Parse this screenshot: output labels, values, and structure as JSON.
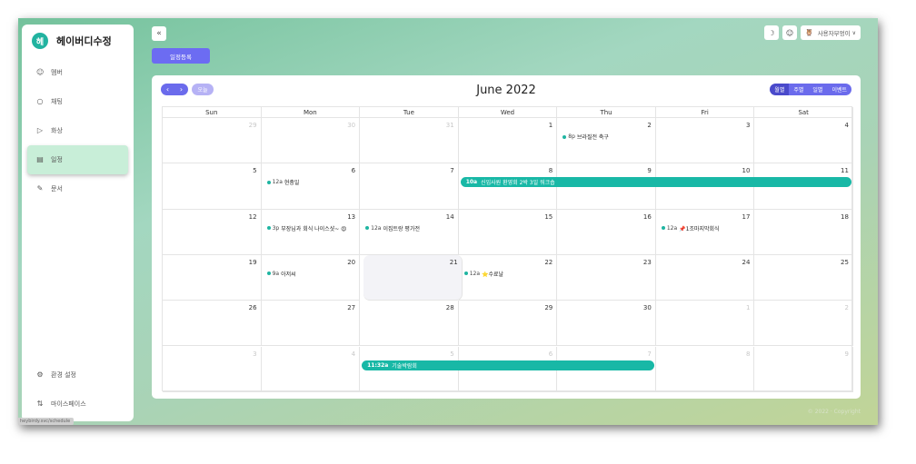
{
  "brand": {
    "logo": "헤",
    "name": "헤이버디수정"
  },
  "sidebar": {
    "items": [
      {
        "label": "멤버",
        "icon": "user-icon"
      },
      {
        "label": "채팅",
        "icon": "chat-icon"
      },
      {
        "label": "화상",
        "icon": "video-icon"
      },
      {
        "label": "일정",
        "icon": "calendar-icon",
        "active": true
      },
      {
        "label": "문서",
        "icon": "edit-icon"
      }
    ],
    "bottom": [
      {
        "label": "환경 설정",
        "icon": "gear-icon"
      },
      {
        "label": "마이스페이스",
        "icon": "switch-icon"
      }
    ],
    "status_tip": "heybirdy.svc/schedule"
  },
  "toolbar": {
    "add_label": "일정등록",
    "user_label": "사용자부엉이"
  },
  "calendar": {
    "title": "June 2022",
    "today_label": "오늘",
    "views": [
      "월별",
      "주별",
      "일별",
      "이벤트"
    ],
    "active_view": "월별",
    "weekdays": [
      "Sun",
      "Mon",
      "Tue",
      "Wed",
      "Thu",
      "Fri",
      "Sat"
    ],
    "weeks": [
      [
        {
          "d": "29",
          "o": true
        },
        {
          "d": "30",
          "o": true
        },
        {
          "d": "31",
          "o": true
        },
        {
          "d": "1"
        },
        {
          "d": "2"
        },
        {
          "d": "3"
        },
        {
          "d": "4"
        }
      ],
      [
        {
          "d": "5"
        },
        {
          "d": "6"
        },
        {
          "d": "7"
        },
        {
          "d": "8"
        },
        {
          "d": "9"
        },
        {
          "d": "10"
        },
        {
          "d": "11"
        }
      ],
      [
        {
          "d": "12"
        },
        {
          "d": "13"
        },
        {
          "d": "14"
        },
        {
          "d": "15"
        },
        {
          "d": "16"
        },
        {
          "d": "17"
        },
        {
          "d": "18"
        }
      ],
      [
        {
          "d": "19"
        },
        {
          "d": "20"
        },
        {
          "d": "21",
          "t": true
        },
        {
          "d": "22"
        },
        {
          "d": "23"
        },
        {
          "d": "24"
        },
        {
          "d": "25"
        }
      ],
      [
        {
          "d": "26"
        },
        {
          "d": "27"
        },
        {
          "d": "28"
        },
        {
          "d": "29"
        },
        {
          "d": "30"
        },
        {
          "d": "1",
          "o": true
        },
        {
          "d": "2",
          "o": true
        }
      ],
      [
        {
          "d": "3",
          "o": true
        },
        {
          "d": "4",
          "o": true
        },
        {
          "d": "5",
          "o": true
        },
        {
          "d": "6",
          "o": true
        },
        {
          "d": "7",
          "o": true
        },
        {
          "d": "8",
          "o": true
        },
        {
          "d": "9",
          "o": true
        }
      ]
    ],
    "events": [
      {
        "week": 0,
        "day": 4,
        "time": "8p",
        "title": "브라질전 축구"
      },
      {
        "week": 1,
        "day": 1,
        "time": "12a",
        "title": "현충일"
      },
      {
        "week": 2,
        "day": 1,
        "time": "3p",
        "title": "부장님과 회식 나이스샷~ 😍"
      },
      {
        "week": 2,
        "day": 2,
        "time": "12a",
        "title": "이집트랑 평가전"
      },
      {
        "week": 2,
        "day": 5,
        "time": "12a",
        "title": "📌1조마지막회식"
      },
      {
        "week": 3,
        "day": 1,
        "time": "9a",
        "title": "아저씨"
      },
      {
        "week": 3,
        "day": 3,
        "time": "12a",
        "title": "⭐수료날"
      }
    ],
    "bars": [
      {
        "week": 1,
        "start": 3,
        "span": 4,
        "time": "10a",
        "title": "신입사원 환영회 2박 3일 워크숍"
      },
      {
        "week": 5,
        "start": 2,
        "span": 3,
        "time": "11:32a",
        "title": "기술박람회"
      }
    ]
  },
  "footer": {
    "copyright": "© 2022 · Copyright"
  },
  "colors": {
    "accent": "#6b6bec",
    "event": "#18b8a6",
    "active_nav": "#c8eed8"
  }
}
